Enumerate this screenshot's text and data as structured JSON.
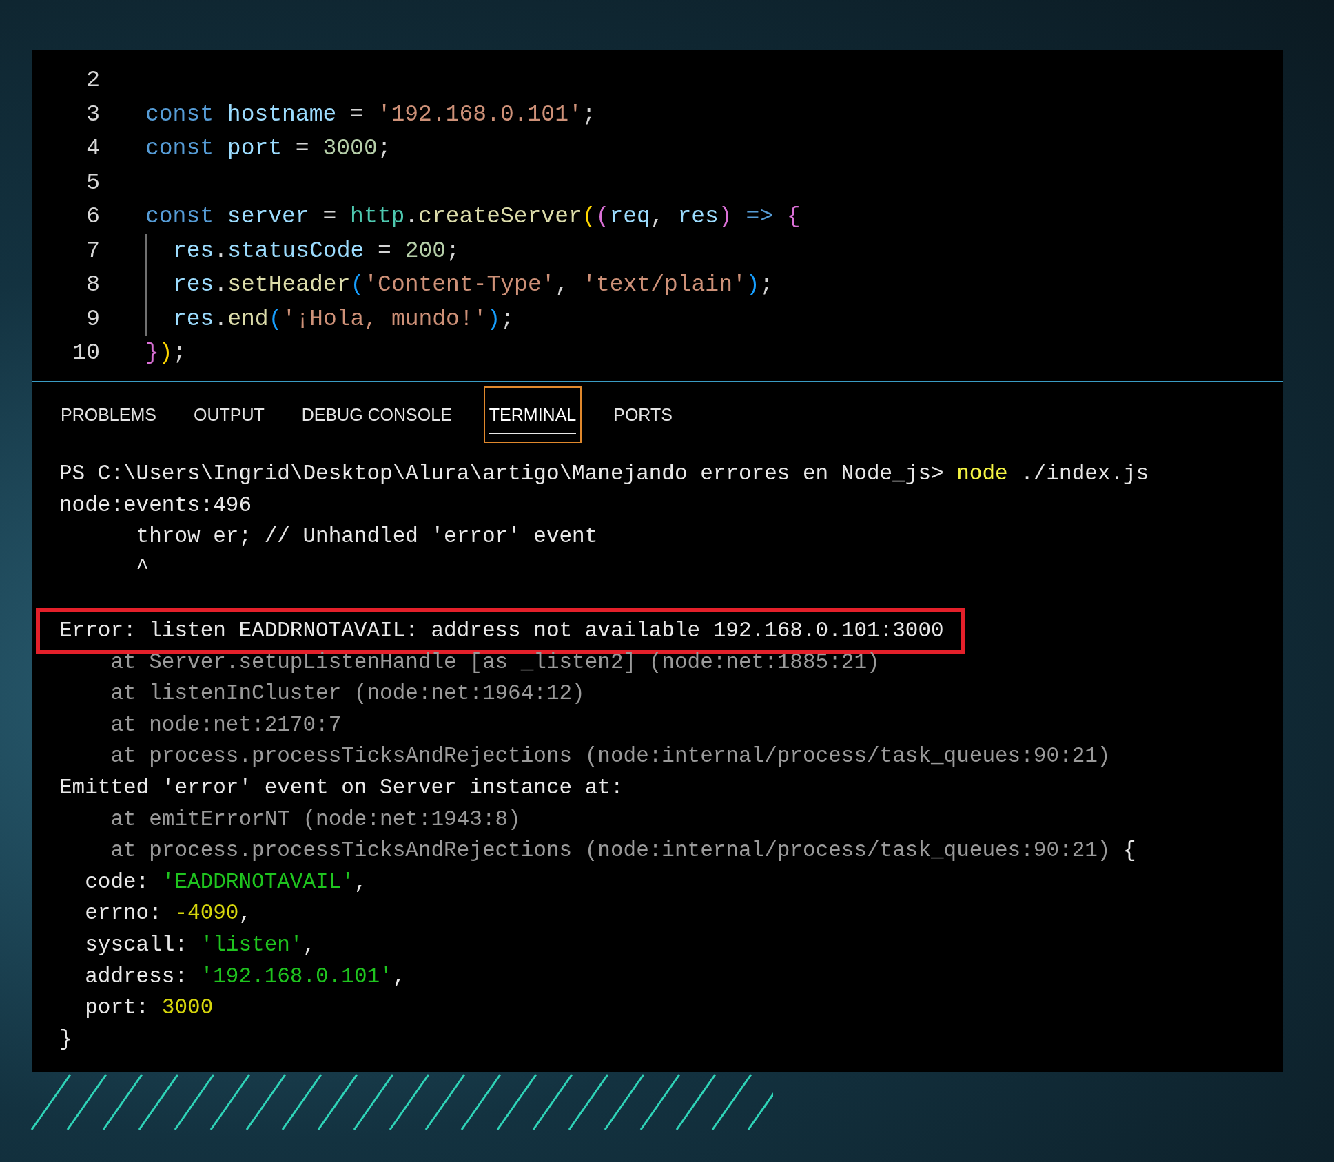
{
  "editor": {
    "lines": [
      {
        "number": "2",
        "indent_guide": false
      },
      {
        "number": "3",
        "indent_guide": false,
        "tokens": [
          {
            "text": "const",
            "kind": "keyword"
          },
          {
            "text": " hostname",
            "kind": "variable"
          },
          {
            "text": " = ",
            "kind": "punct"
          },
          {
            "text": "'192.168.0.101'",
            "kind": "string"
          },
          {
            "text": ";",
            "kind": "punct"
          }
        ]
      },
      {
        "number": "4",
        "indent_guide": false,
        "tokens": [
          {
            "text": "const",
            "kind": "keyword"
          },
          {
            "text": " port",
            "kind": "variable"
          },
          {
            "text": " = ",
            "kind": "punct"
          },
          {
            "text": "3000",
            "kind": "number"
          },
          {
            "text": ";",
            "kind": "punct"
          }
        ]
      },
      {
        "number": "5",
        "indent_guide": false
      },
      {
        "number": "6",
        "indent_guide": false,
        "tokens": [
          {
            "text": "const",
            "kind": "keyword"
          },
          {
            "text": " server",
            "kind": "variable"
          },
          {
            "text": " = ",
            "kind": "punct"
          },
          {
            "text": "http",
            "kind": "module"
          },
          {
            "text": ".",
            "kind": "punct"
          },
          {
            "text": "createServer",
            "kind": "function"
          },
          {
            "text": "(",
            "kind": "bracket1"
          },
          {
            "text": "(",
            "kind": "bracket2"
          },
          {
            "text": "req",
            "kind": "variable"
          },
          {
            "text": ", ",
            "kind": "punct"
          },
          {
            "text": "res",
            "kind": "variable"
          },
          {
            "text": ")",
            "kind": "bracket2"
          },
          {
            "text": " => ",
            "kind": "keyword"
          },
          {
            "text": "{",
            "kind": "bracket2"
          }
        ]
      },
      {
        "number": "7",
        "indent_guide": true,
        "tokens": [
          {
            "text": "res",
            "kind": "variable"
          },
          {
            "text": ".",
            "kind": "punct"
          },
          {
            "text": "statusCode",
            "kind": "variable"
          },
          {
            "text": " = ",
            "kind": "punct"
          },
          {
            "text": "200",
            "kind": "number"
          },
          {
            "text": ";",
            "kind": "punct"
          }
        ]
      },
      {
        "number": "8",
        "indent_guide": true,
        "tokens": [
          {
            "text": "res",
            "kind": "variable"
          },
          {
            "text": ".",
            "kind": "punct"
          },
          {
            "text": "setHeader",
            "kind": "function"
          },
          {
            "text": "(",
            "kind": "bracket3"
          },
          {
            "text": "'Content-Type'",
            "kind": "string"
          },
          {
            "text": ", ",
            "kind": "punct"
          },
          {
            "text": "'text/plain'",
            "kind": "string"
          },
          {
            "text": ")",
            "kind": "bracket3"
          },
          {
            "text": ";",
            "kind": "punct"
          }
        ]
      },
      {
        "number": "9",
        "indent_guide": true,
        "tokens": [
          {
            "text": "res",
            "kind": "variable"
          },
          {
            "text": ".",
            "kind": "punct"
          },
          {
            "text": "end",
            "kind": "function"
          },
          {
            "text": "(",
            "kind": "bracket3"
          },
          {
            "text": "'¡Hola, mundo!'",
            "kind": "string"
          },
          {
            "text": ")",
            "kind": "bracket3"
          },
          {
            "text": ";",
            "kind": "punct"
          }
        ]
      },
      {
        "number": "10",
        "indent_guide": false,
        "tokens": [
          {
            "text": "}",
            "kind": "bracket2"
          },
          {
            "text": ")",
            "kind": "bracket1"
          },
          {
            "text": ";",
            "kind": "punct"
          }
        ]
      }
    ]
  },
  "panel_tabs": [
    {
      "label": "PROBLEMS",
      "selected": false
    },
    {
      "label": "OUTPUT",
      "selected": false
    },
    {
      "label": "DEBUG CONSOLE",
      "selected": false
    },
    {
      "label": "TERMINAL",
      "selected": true
    },
    {
      "label": "PORTS",
      "selected": false
    }
  ],
  "terminal": {
    "lines": [
      {
        "highlighted": false,
        "tokens": [
          {
            "text": "PS C:\\Users\\Ingrid\\Desktop\\Alura\\artigo\\Manejando errores en Node_js> ",
            "kind": "plain"
          },
          {
            "text": "node",
            "kind": "command"
          },
          {
            "text": " ./index.js",
            "kind": "plain"
          }
        ]
      },
      {
        "highlighted": false,
        "tokens": [
          {
            "text": "node:events:496",
            "kind": "plain"
          }
        ]
      },
      {
        "highlighted": false,
        "tokens": [
          {
            "text": "      throw er; // Unhandled 'error' event",
            "kind": "plain"
          }
        ]
      },
      {
        "highlighted": false,
        "tokens": [
          {
            "text": "      ^",
            "kind": "plain"
          }
        ]
      },
      {
        "highlighted": false
      },
      {
        "highlighted": true,
        "tokens": [
          {
            "text": "Error: listen EADDRNOTAVAIL: address not available 192.168.0.101:3000",
            "kind": "plain"
          }
        ]
      },
      {
        "highlighted": false,
        "tokens": [
          {
            "text": "    at Server.setupListenHandle [as _listen2] (node:net:1885:21)",
            "kind": "dim"
          }
        ]
      },
      {
        "highlighted": false,
        "tokens": [
          {
            "text": "    at listenInCluster (node:net:1964:12)",
            "kind": "dim"
          }
        ]
      },
      {
        "highlighted": false,
        "tokens": [
          {
            "text": "    at node:net:2170:7",
            "kind": "dim"
          }
        ]
      },
      {
        "highlighted": false,
        "tokens": [
          {
            "text": "    at process.processTicksAndRejections (node:internal/process/task_queues:90:21)",
            "kind": "dim"
          }
        ]
      },
      {
        "highlighted": false,
        "tokens": [
          {
            "text": "Emitted 'error' event on Server instance at:",
            "kind": "plain"
          }
        ]
      },
      {
        "highlighted": false,
        "tokens": [
          {
            "text": "    at emitErrorNT (node:net:1943:8)",
            "kind": "dim"
          }
        ]
      },
      {
        "highlighted": false,
        "tokens": [
          {
            "text": "    at process.processTicksAndRejections (node:internal/process/task_queues:90:21)",
            "kind": "dim"
          },
          {
            "text": " {",
            "kind": "plain"
          }
        ]
      },
      {
        "highlighted": false,
        "tokens": [
          {
            "text": "  code: ",
            "kind": "plain"
          },
          {
            "text": "'EADDRNOTAVAIL'",
            "kind": "string"
          },
          {
            "text": ",",
            "kind": "plain"
          }
        ]
      },
      {
        "highlighted": false,
        "tokens": [
          {
            "text": "  errno: ",
            "kind": "plain"
          },
          {
            "text": "-4090",
            "kind": "number"
          },
          {
            "text": ",",
            "kind": "plain"
          }
        ]
      },
      {
        "highlighted": false,
        "tokens": [
          {
            "text": "  syscall: ",
            "kind": "plain"
          },
          {
            "text": "'listen'",
            "kind": "string"
          },
          {
            "text": ",",
            "kind": "plain"
          }
        ]
      },
      {
        "highlighted": false,
        "tokens": [
          {
            "text": "  address: ",
            "kind": "plain"
          },
          {
            "text": "'192.168.0.101'",
            "kind": "string"
          },
          {
            "text": ",",
            "kind": "plain"
          }
        ]
      },
      {
        "highlighted": false,
        "tokens": [
          {
            "text": "  port: ",
            "kind": "plain"
          },
          {
            "text": "3000",
            "kind": "number"
          }
        ]
      },
      {
        "highlighted": false,
        "tokens": [
          {
            "text": "}",
            "kind": "plain"
          }
        ]
      }
    ]
  }
}
